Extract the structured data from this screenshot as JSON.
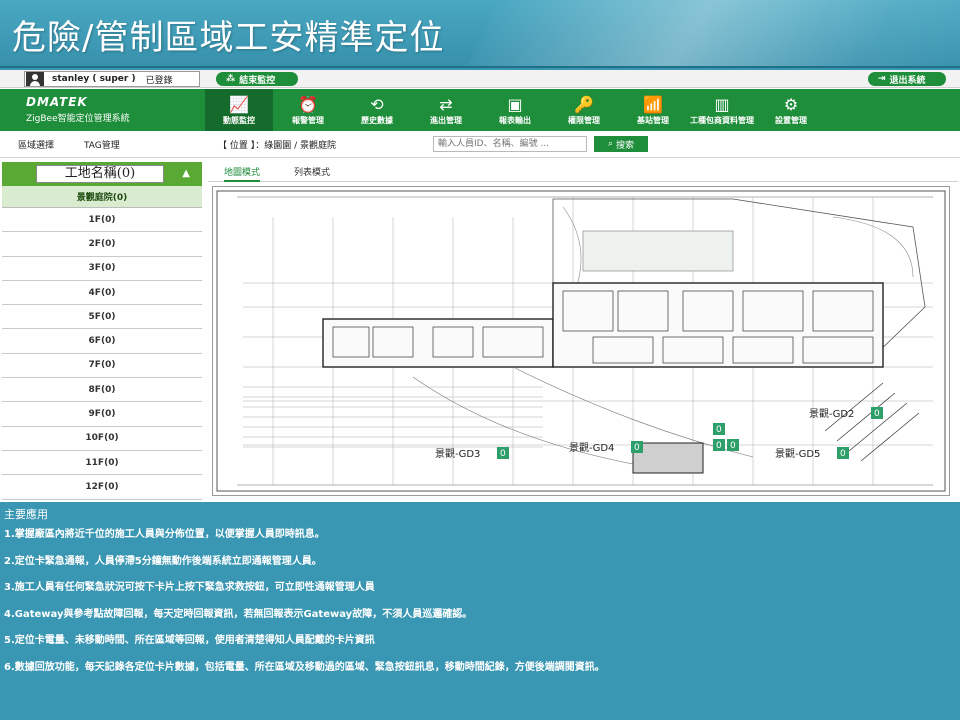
{
  "slide": {
    "title": "危險/管制區域工安精準定位"
  },
  "userbar": {
    "user": "stanley ( super )",
    "status": "已登錄",
    "stop_monitor": "結束監控",
    "logout": "退出系統"
  },
  "brand": {
    "name": "DMATEK",
    "subtitle": "ZigBee智能定位管理系統"
  },
  "nav": [
    {
      "label": "動態監控",
      "icon": "monitor-icon",
      "glyph": "📈"
    },
    {
      "label": "報警管理",
      "icon": "alarm-icon",
      "glyph": "⏰"
    },
    {
      "label": "歷史數據",
      "icon": "history-icon",
      "glyph": "⟲"
    },
    {
      "label": "進出管理",
      "icon": "access-icon",
      "glyph": "⇄"
    },
    {
      "label": "報表輸出",
      "icon": "report-icon",
      "glyph": "▣"
    },
    {
      "label": "權限管理",
      "icon": "permission-icon",
      "glyph": "🔑"
    },
    {
      "label": "基站管理",
      "icon": "base-station-icon",
      "glyph": "📶"
    },
    {
      "label": "工種包商資料管理",
      "icon": "contractor-icon",
      "glyph": "▥"
    },
    {
      "label": "設置管理",
      "icon": "settings-icon",
      "glyph": "⚙"
    }
  ],
  "subbar": {
    "tab_area": "區域選擇",
    "tab_tag": "TAG管理",
    "location": "【 位置 】：綠園園 / 景觀庭院",
    "search_placeholder": "輸入人員ID、名稱、編號 ...",
    "search_button": "搜索"
  },
  "sidebar": {
    "site_title": "工地名稱(0)",
    "group": "景觀庭院(0)",
    "floors": [
      "1F(0)",
      "2F(0)",
      "3F(0)",
      "4F(0)",
      "5F(0)",
      "6F(0)",
      "7F(0)",
      "8F(0)",
      "9F(0)",
      "10F(0)",
      "11F(0)",
      "12F(0)"
    ]
  },
  "viewtabs": {
    "map": "地圖模式",
    "list": "列表模式"
  },
  "map": {
    "zones": [
      {
        "label": "景觀-GD3",
        "count": "0"
      },
      {
        "label": "景觀-GD4",
        "count": "0"
      },
      {
        "label": "景觀-GD5",
        "count": "0"
      },
      {
        "label": "景觀-GD2",
        "count": "0"
      }
    ],
    "misc_counts": [
      "0",
      "0",
      "0"
    ]
  },
  "notes": {
    "title": "主要應用",
    "items": [
      "1.掌握廠區內將近千位的施工人員與分佈位置，以便掌握人員即時訊息。",
      "2.定位卡緊急通報，人員停滯5分鐘無動作後端系統立即通報管理人員。",
      "3.施工人員有任何緊急狀況可按下卡片上按下緊急求救按鈕，可立即性通報管理人員",
      "4.Gateway與參考點故障回報，每天定時回報資訊，若無回報表示Gateway故障，不須人員巡邏確認。",
      "5.定位卡電量、未移動時間、所在區域等回報，使用者清楚得知人員配戴的卡片資訊",
      "6.數據回放功能，每天記錄各定位卡片數據，包括電量、所在區域及移動過的區域、緊急按鈕訊息，移動時間紀錄，方便後端調閱資訊。"
    ]
  },
  "colors": {
    "slide_bg": "#3a97b3",
    "app_green": "#1f8e3b",
    "sidebar_head": "#5aa935"
  }
}
